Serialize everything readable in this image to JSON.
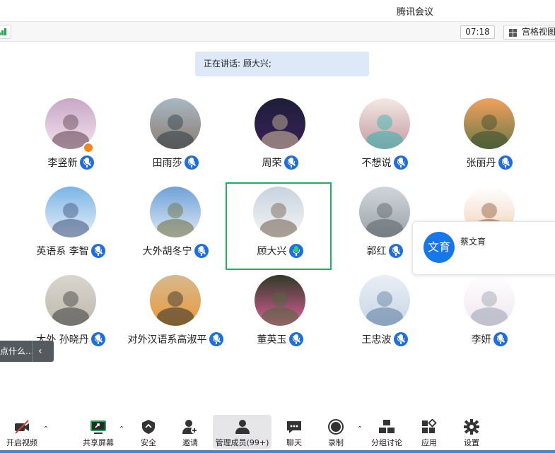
{
  "window": {
    "title": "腾讯会议"
  },
  "infobar": {
    "timer": "07:18",
    "gallery_label": "宫格视图"
  },
  "speaking": {
    "text": "正在讲话: 顾大兴;"
  },
  "participants": [
    {
      "name": "李竖新",
      "mic": "off",
      "host": true,
      "avatar_colors": [
        "#c9a7c6",
        "#f3e2ee",
        "#5b3d4a"
      ]
    },
    {
      "name": "田雨莎",
      "mic": "off",
      "avatar_colors": [
        "#a9b8c4",
        "#8a7d70",
        "#2d3a46"
      ]
    },
    {
      "name": "周荣",
      "mic": "off",
      "avatar_colors": [
        "#1c1f3a",
        "#3a1f55",
        "#d9c7a0"
      ]
    },
    {
      "name": "不想说",
      "mic": "off",
      "avatar_colors": [
        "#f3e9e4",
        "#c59aa0",
        "#2fb3b0"
      ]
    },
    {
      "name": "张丽丹",
      "mic": "off",
      "avatar_colors": [
        "#f2a05a",
        "#6a7a4a",
        "#394a2c"
      ]
    },
    {
      "name": "英语系 李智",
      "mic": "off",
      "avatar_colors": [
        "#7bb5e6",
        "#e6eef6",
        "#3c4e7a"
      ]
    },
    {
      "name": "大外胡冬宁",
      "mic": "off",
      "avatar_colors": [
        "#6fa2d8",
        "#dfe9f3",
        "#6b6a3a"
      ]
    },
    {
      "name": "顾大兴",
      "mic": "on",
      "active": true,
      "avatar_colors": [
        "#c7d3e0",
        "#f5f5f5",
        "#6d5a4a"
      ]
    },
    {
      "name": "郭红",
      "mic": "off",
      "avatar_colors": [
        "#d0d6dc",
        "#9aa3aa",
        "#5a6066"
      ]
    },
    {
      "name": "",
      "mic": "none",
      "avatar_colors": [
        "#ffffff",
        "#f1d1b8",
        "#8b5a3a"
      ]
    },
    {
      "name": "大外 孙晓丹",
      "mic": "off",
      "avatar_colors": [
        "#d9d6cf",
        "#bfb9ad",
        "#3a3a3a"
      ]
    },
    {
      "name": "对外汉语系高淑平",
      "mic": "off",
      "avatar_colors": [
        "#d8b98e",
        "#e79a3a",
        "#2b2b2b"
      ]
    },
    {
      "name": "董英玉",
      "mic": "off",
      "avatar_colors": [
        "#2d3a26",
        "#e05e98",
        "#4a6a3a"
      ]
    },
    {
      "name": "王忠波",
      "mic": "off",
      "avatar_colors": [
        "#e9eef6",
        "#c7d6e6",
        "#5a7a9a"
      ]
    },
    {
      "name": "李妍",
      "mic": "off",
      "avatar_colors": [
        "#ffffff",
        "#efe6ee",
        "#9aa0b0"
      ]
    }
  ],
  "floating_card": {
    "initials": "文育",
    "name": "蔡文育"
  },
  "chat_hint": {
    "text": "点什么..."
  },
  "toolbar": {
    "video": "开启视频",
    "share": "共享屏幕",
    "security": "安全",
    "invite": "邀请",
    "members": "管理成员(99+)",
    "chat": "聊天",
    "record": "录制",
    "breakout": "分组讨论",
    "apps": "应用",
    "settings": "设置"
  },
  "colors": {
    "accent": "#1d6ee6",
    "speaking_bg": "#dde9f9",
    "active_border": "#1fb45a",
    "share_green": "#1fa257"
  }
}
